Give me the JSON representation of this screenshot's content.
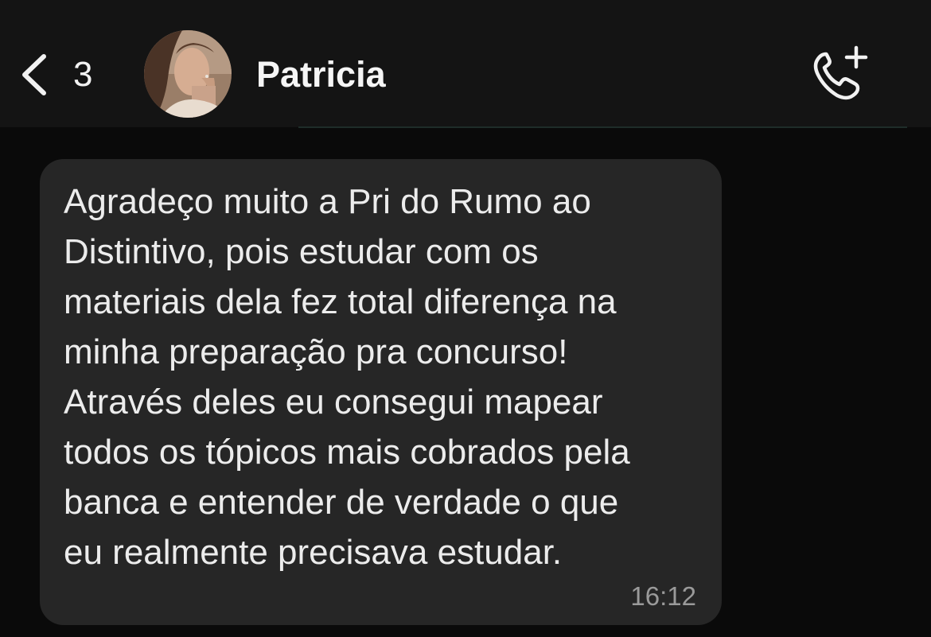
{
  "header": {
    "back_count": "3",
    "contact_name": "Patricia",
    "icons": {
      "back": "chevron-left-icon",
      "call": "phone-plus-icon"
    }
  },
  "message": {
    "text": "Agradeço muito a Pri do Rumo ao\nDistintivo, pois estudar com os\nmateriais dela fez total diferença na\nminha preparação pra concurso!\nAtravés deles eu consegui mapear\ntodos os tópicos mais cobrados pela\nbanca e entender de verdade o que\neu realmente precisava estudar.",
    "time": "16:12"
  },
  "colors": {
    "background": "#0a0a0a",
    "header": "#141414",
    "bubble": "#262626",
    "text": "#ececec",
    "timestamp": "#9a9a9a"
  }
}
